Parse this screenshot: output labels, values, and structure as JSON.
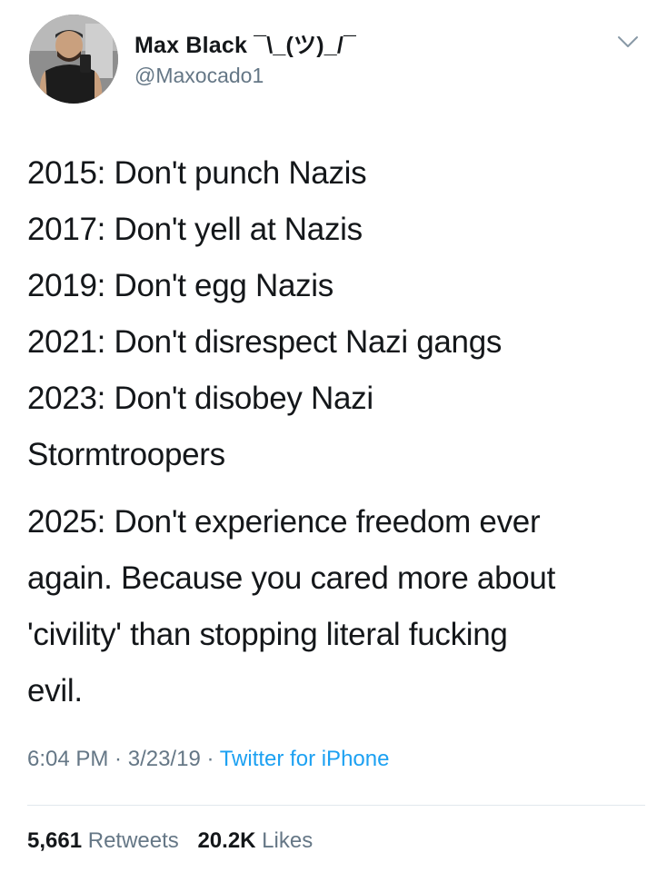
{
  "author": {
    "name": "Max Black ¯\\_(ツ)_/¯",
    "handle": "@Maxocado1"
  },
  "tweet": {
    "lines": [
      "2015: Don't punch Nazis",
      "2017: Don't yell at Nazis",
      "2019: Don't egg Nazis",
      "2021: Don't disrespect Nazi gangs",
      "2023: Don't disobey Nazi",
      "Stormtroopers"
    ],
    "lines2": [
      "2025: Don't experience freedom ever",
      "again. Because you cared more about",
      "'civility' than stopping literal fucking",
      "evil."
    ]
  },
  "meta": {
    "time": "6:04 PM",
    "sep1": " · ",
    "date": "3/23/19",
    "sep2": " · ",
    "source": "Twitter for iPhone"
  },
  "stats": {
    "retweets_count": "5,661",
    "retweets_label": "Retweets",
    "likes_count": "20.2K",
    "likes_label": "Likes"
  },
  "icons": {
    "menu": "chevron-down-icon",
    "avatar": "avatar"
  },
  "colors": {
    "text": "#14171a",
    "secondary": "#657786",
    "link": "#1da1f2",
    "divider": "#e1e8ed"
  }
}
